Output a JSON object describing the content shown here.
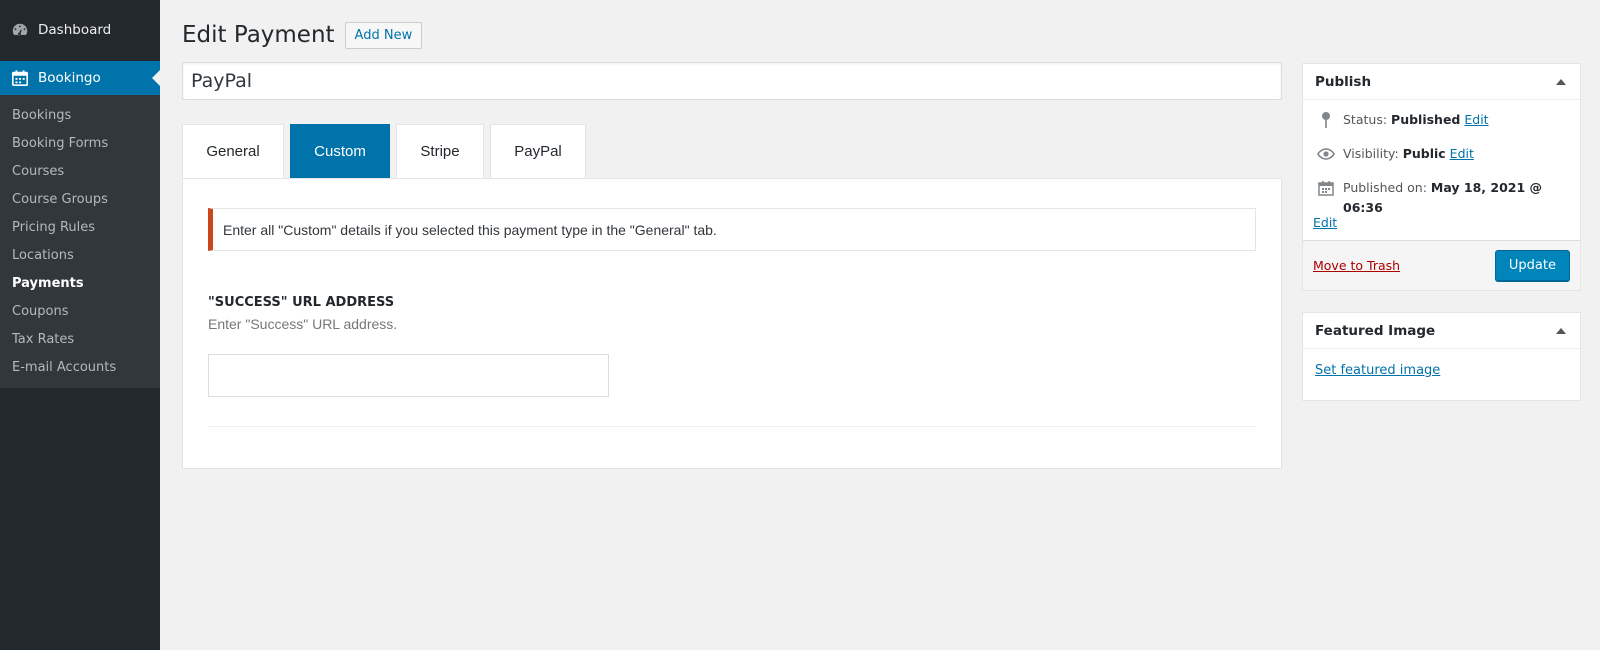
{
  "sidebar": {
    "dashboard": "Dashboard",
    "current": "Bookingo",
    "items": [
      {
        "label": "Bookings"
      },
      {
        "label": "Booking Forms"
      },
      {
        "label": "Courses"
      },
      {
        "label": "Course Groups"
      },
      {
        "label": "Pricing Rules"
      },
      {
        "label": "Locations"
      },
      {
        "label": "Payments",
        "active": true
      },
      {
        "label": "Coupons"
      },
      {
        "label": "Tax Rates"
      },
      {
        "label": "E-mail Accounts"
      }
    ]
  },
  "header": {
    "title": "Edit Payment",
    "add_new": "Add New"
  },
  "post_title": "PayPal",
  "tabs": [
    {
      "label": "General"
    },
    {
      "label": "Custom",
      "active": true
    },
    {
      "label": "Stripe"
    },
    {
      "label": "PayPal"
    }
  ],
  "notice": "Enter all \"Custom\" details if you selected this payment type in the \"General\" tab.",
  "success_field": {
    "label": "\"SUCCESS\" URL ADDRESS",
    "description": "Enter \"Success\" URL address.",
    "value": ""
  },
  "publish": {
    "title": "Publish",
    "status_label": "Status:",
    "status_value": "Published",
    "visibility_label": "Visibility:",
    "visibility_value": "Public",
    "published_label": "Published on:",
    "published_value": "May 18, 2021 @ 06:36",
    "edit": "Edit",
    "trash": "Move to Trash",
    "update": "Update"
  },
  "featured_image": {
    "title": "Featured Image",
    "link": "Set featured image"
  },
  "colors": {
    "accent": "#0073aa",
    "sidebar_bg": "#23282d",
    "notice_border": "#c9471a",
    "trash": "#aa0000"
  }
}
